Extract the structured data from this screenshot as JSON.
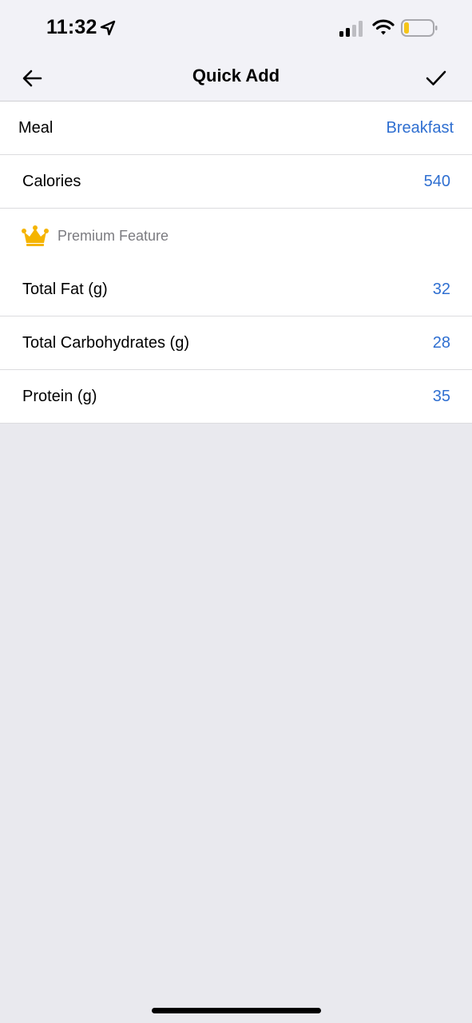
{
  "status_bar": {
    "time": "11:32",
    "icons": [
      "location-arrow-icon",
      "cellular-signal-icon",
      "wifi-icon",
      "battery-icon"
    ]
  },
  "nav": {
    "title": "Quick Add",
    "back_icon": "arrow-left-icon",
    "done_icon": "checkmark-icon"
  },
  "form": {
    "meal": {
      "label": "Meal",
      "value": "Breakfast"
    },
    "calories": {
      "label": "Calories",
      "value": "540"
    },
    "premium": {
      "label": "Premium Feature",
      "icon": "crown-icon"
    },
    "nutrients": [
      {
        "label": "Total Fat (g)",
        "value": "32"
      },
      {
        "label": "Total Carbohydrates (g)",
        "value": "28"
      },
      {
        "label": "Protein (g)",
        "value": "35"
      }
    ]
  },
  "colors": {
    "accent": "#2f6fd1",
    "background": "#e9e9ee",
    "crown": "#f5b400",
    "battery_low": "#f5c518"
  }
}
